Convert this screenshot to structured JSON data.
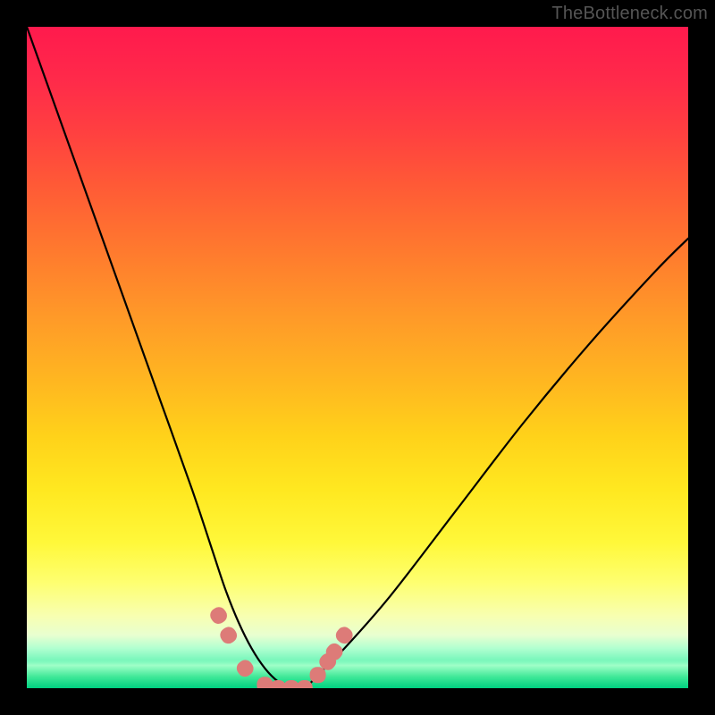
{
  "watermark": "TheBottleneck.com",
  "chart_data": {
    "type": "line",
    "title": "",
    "xlabel": "",
    "ylabel": "",
    "xlim": [
      0,
      100
    ],
    "ylim": [
      0,
      100
    ],
    "series": [
      {
        "name": "bottleneck-curve",
        "x": [
          0,
          5,
          10,
          15,
          20,
          25,
          28,
          30,
          32,
          34,
          36,
          38,
          40,
          42,
          44,
          48,
          55,
          65,
          75,
          85,
          95,
          100
        ],
        "values": [
          100,
          86,
          72,
          58,
          44,
          30,
          21,
          15,
          10,
          6,
          3,
          1,
          0,
          0,
          2,
          6,
          14,
          27,
          40,
          52,
          63,
          68
        ]
      }
    ],
    "annotations": [
      {
        "name": "marker-sausage",
        "description": "pink rounded markers near the curve minimum",
        "points_xy": [
          [
            29,
            11
          ],
          [
            30.5,
            8
          ],
          [
            33,
            3
          ],
          [
            36,
            0.5
          ],
          [
            38,
            0
          ],
          [
            40,
            0
          ],
          [
            42,
            0
          ],
          [
            44,
            2
          ],
          [
            45.5,
            4
          ],
          [
            46.5,
            5.5
          ],
          [
            48,
            8
          ]
        ],
        "color": "#dd7b78",
        "size": 18
      }
    ],
    "background_gradient": {
      "top": "#ff1a4d",
      "mid": "#ffe020",
      "bottom": "#00d888"
    }
  }
}
